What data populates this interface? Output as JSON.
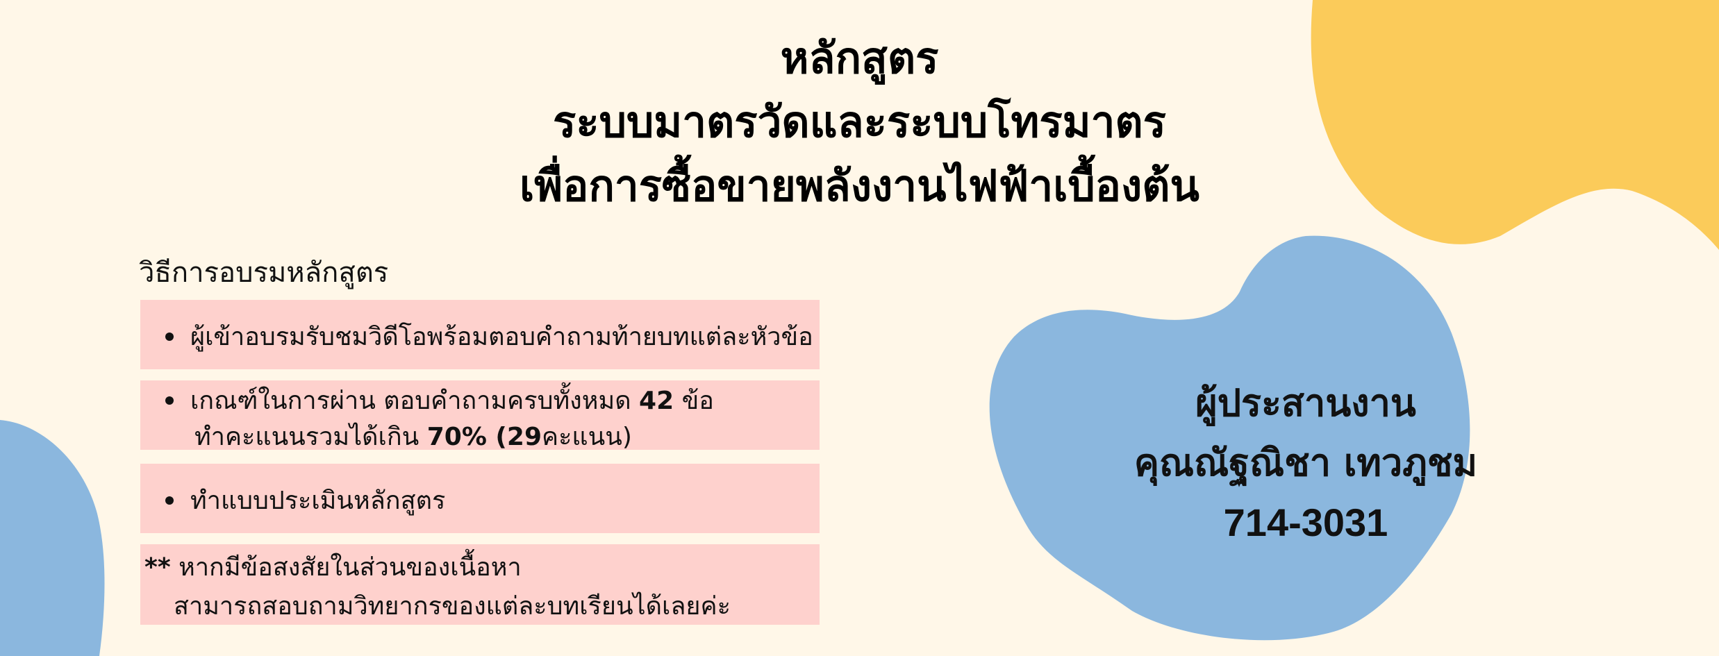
{
  "title": {
    "line1": "หลักสูตร",
    "line2": "ระบบมาตรวัดและระบบโทรมาตร",
    "line3": "เพื่อการซื้อขายพลังงานไฟฟ้าเบื้องต้น"
  },
  "training": {
    "heading": "วิธีการอบรมหลักสูตร",
    "item1": "ผู้เข้าอบรมรับชมวิดีโอพร้อมตอบคำถามท้ายบทแต่ละหัวข้อ",
    "item2": {
      "line1_prefix": "เกณฑ์ในการผ่าน ตอบคำถามครบทั้งหมด ",
      "line1_number": "42",
      "line1_suffix": " ข้อ",
      "line2_prefix": "ทำคะแนนรวมได้เกิน ",
      "line2_percent": "70%",
      "line2_open": " (",
      "line2_number": "29",
      "line2_suffix": "คะแนน)"
    },
    "item3": "ทำแบบประเมินหลักสูตร",
    "note": {
      "stars": "**",
      "line1": " หากมีข้อสงสัยในส่วนของเนื้อหา",
      "line2": "สามารถสอบถามวิทยากรของแต่ละบทเรียนได้เลยค่ะ"
    }
  },
  "contact": {
    "label": "ผู้ประสานงาน",
    "name": "คุณณัฐณิชา เทวภูชม",
    "phone": "714-3031"
  },
  "colors": {
    "background": "#fff7e8",
    "yellow_blob": "#fbcb5a",
    "blue_blob": "#8bb7de",
    "box_fill": "#fed1cd"
  }
}
